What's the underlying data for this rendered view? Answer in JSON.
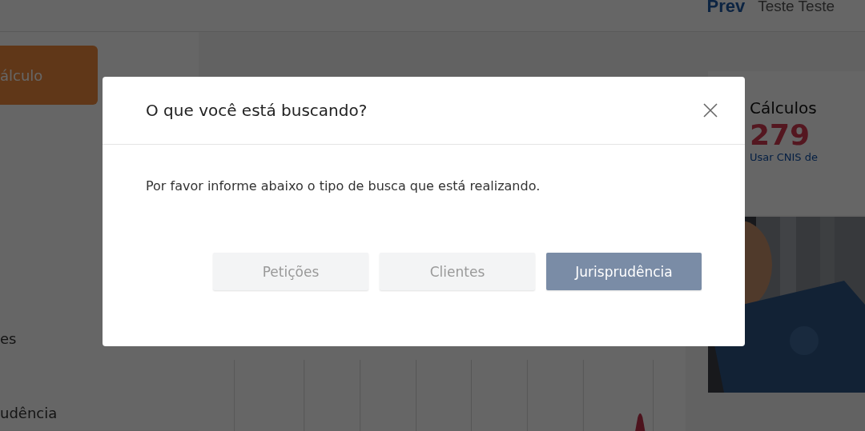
{
  "header": {
    "brand": "Prev",
    "user": "Teste Teste"
  },
  "sidebar": {
    "items": [
      {
        "label": "álculo",
        "kind": "primary"
      },
      {
        "label": "es",
        "kind": "link"
      },
      {
        "label": "udência",
        "kind": "link"
      }
    ]
  },
  "summary_card": {
    "title": "Cálculos",
    "count": "279",
    "link": "Usar CNIS de"
  },
  "modal": {
    "title": "O que você está buscando?",
    "message": "Por favor informe abaixo o tipo de busca que está realizando.",
    "options": [
      {
        "label": "Petições",
        "selected": false
      },
      {
        "label": "Clientes",
        "selected": false
      },
      {
        "label": "Jurisprudência",
        "selected": true
      }
    ]
  }
}
